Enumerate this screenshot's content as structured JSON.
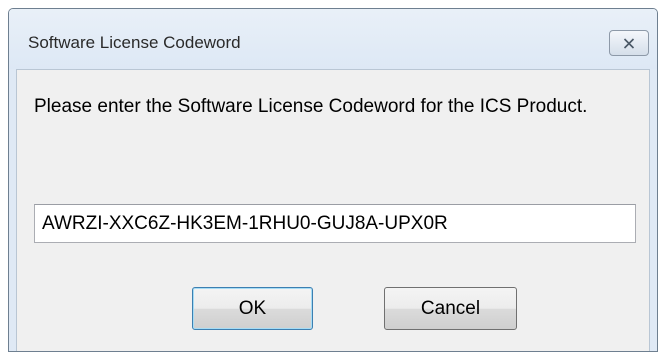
{
  "dialog": {
    "title": "Software License Codeword",
    "close_icon": "close-icon",
    "prompt": "Please enter the Software License Codeword for the ICS Product.",
    "codeword_value": "AWRZI-XXC6Z-HK3EM-1RHU0-GUJ8A-UPX0R",
    "ok_label": "OK",
    "cancel_label": "Cancel"
  },
  "colors": {
    "titlebar": "#dde8f5",
    "client_background": "#f0f0f0",
    "default_button_border": "#3c7fb1"
  }
}
